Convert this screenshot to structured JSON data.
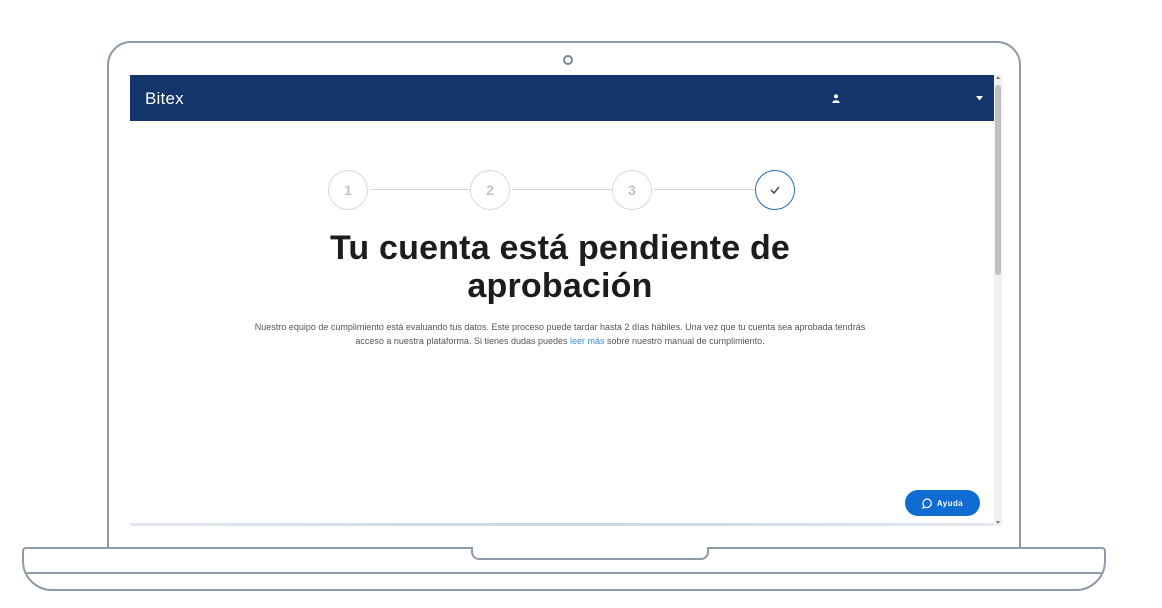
{
  "navbar": {
    "brand": "Bitex",
    "user_icon": "user-icon",
    "menu_icon": "caret-down-icon"
  },
  "stepper": {
    "steps": [
      "1",
      "2",
      "3"
    ],
    "final_icon": "check-icon",
    "active_color": "#2a64b8"
  },
  "content": {
    "title": "Tu cuenta está pendiente de aprobación",
    "body_before_link": "Nuestro equipo de cumplimiento está evaluando tus datos. Este proceso puede tardar hasta 2 días hábiles. Una vez que tu cuenta sea aprobada tendrás acceso a nuestra plataforma. Si tienes dudas puedes ",
    "link_text": "leer más",
    "body_after_link": " sobre nuestro manual de cumplimiento."
  },
  "help": {
    "label": "Ayuda",
    "icon": "chat-bubble-icon"
  },
  "colors": {
    "navbar_bg": "#13356a",
    "accent": "#0e6cd3",
    "link": "#3b8ed8"
  }
}
